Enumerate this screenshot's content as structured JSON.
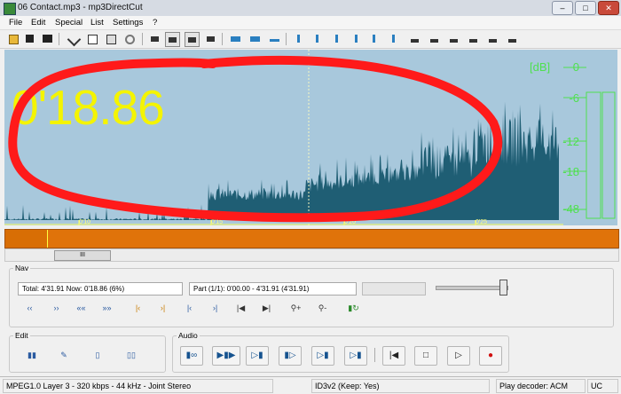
{
  "window": {
    "title": "06 Contact.mp3 - mp3DirectCut"
  },
  "menu": [
    "File",
    "Edit",
    "Special",
    "List",
    "Settings",
    "?"
  ],
  "waveform": {
    "position_display": "0'18.86",
    "db_title": "[dB]",
    "db_scale": [
      "0",
      "-6",
      "-12",
      "-18",
      "-48"
    ],
    "time_ticks": [
      "0'10",
      "0'15",
      "0'20",
      "0'25"
    ],
    "background_color": "#a8c8dc",
    "wave_color": "#1f5e74",
    "timecode_color": "#f4f400",
    "meter_color": "#4fe04f"
  },
  "overview": {
    "color": "#e0730a"
  },
  "scroll": {
    "thumb_label": "III"
  },
  "nav": {
    "legend": "Nav",
    "total_now": "Total: 4'31.91   Now: 0'18.86   (6%)",
    "part": "Part (1/1): 0'00.00 - 4'31.91 (4'31.91)",
    "volume_fraction": 0.95
  },
  "edit": {
    "legend": "Edit"
  },
  "audio": {
    "legend": "Audio"
  },
  "status": {
    "format": "MPEG1.0 Layer 3 - 320 kbps - 44 kHz - Joint Stereo",
    "tag": "ID3v2 (Keep: Yes)",
    "decoder": "Play decoder: ACM",
    "mode": "UC"
  },
  "annotation": {
    "color": "#ff1a1a"
  }
}
